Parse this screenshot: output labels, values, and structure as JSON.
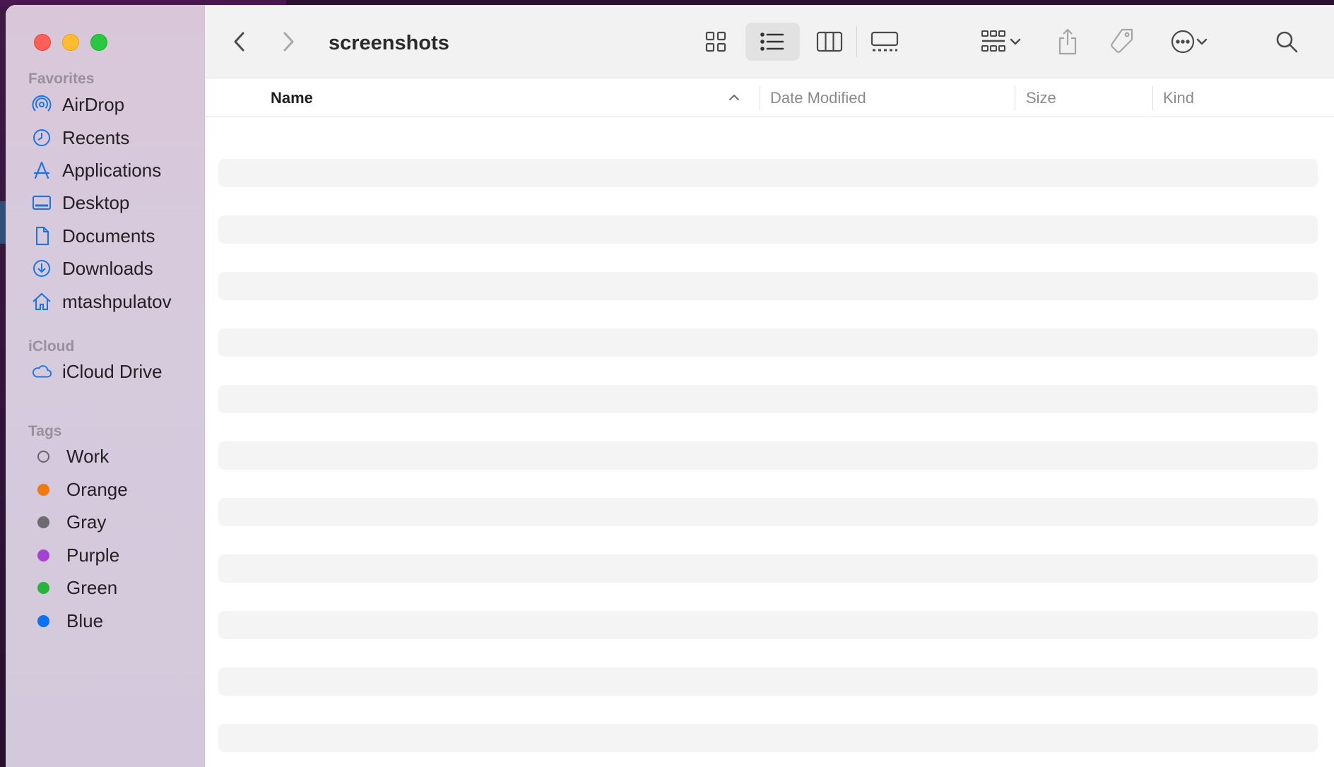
{
  "window": {
    "title": "screenshots",
    "traffic_lights": {
      "close": "#fe5f57",
      "minimize": "#febc2e",
      "maximize": "#28c840"
    }
  },
  "sidebar": {
    "favorites_header": "Favorites",
    "favorites": [
      {
        "label": "AirDrop",
        "icon": "airdrop-icon"
      },
      {
        "label": "Recents",
        "icon": "clock-icon"
      },
      {
        "label": "Applications",
        "icon": "applications-icon"
      },
      {
        "label": "Desktop",
        "icon": "desktop-icon"
      },
      {
        "label": "Documents",
        "icon": "document-icon"
      },
      {
        "label": "Downloads",
        "icon": "download-icon"
      },
      {
        "label": "mtashpulatov",
        "icon": "home-icon"
      }
    ],
    "icloud_header": "iCloud",
    "icloud": [
      {
        "label": "iCloud Drive",
        "icon": "cloud-icon"
      }
    ],
    "tags_header": "Tags",
    "tags": [
      {
        "label": "Work",
        "color": "none"
      },
      {
        "label": "Orange",
        "color": "#f2790d"
      },
      {
        "label": "Gray",
        "color": "#6e6a70"
      },
      {
        "label": "Purple",
        "color": "#a542d4"
      },
      {
        "label": "Green",
        "color": "#27b33a"
      },
      {
        "label": "Blue",
        "color": "#0a72f5"
      }
    ],
    "accent_color": "#1a73e8"
  },
  "toolbar": {
    "back": "back-icon",
    "forward": "forward-icon",
    "views": [
      "icon-view-icon",
      "list-view-icon",
      "column-view-icon",
      "gallery-view-icon"
    ],
    "active_view": "list-view-icon",
    "group": "group-icon",
    "share": "share-icon",
    "tag": "tag-icon",
    "more": "more-icon",
    "search": "search-icon"
  },
  "columns": {
    "name": "Name",
    "date_modified": "Date Modified",
    "size": "Size",
    "kind": "Kind",
    "sort": "ascending"
  },
  "list": {
    "placeholder_rows": 11
  }
}
